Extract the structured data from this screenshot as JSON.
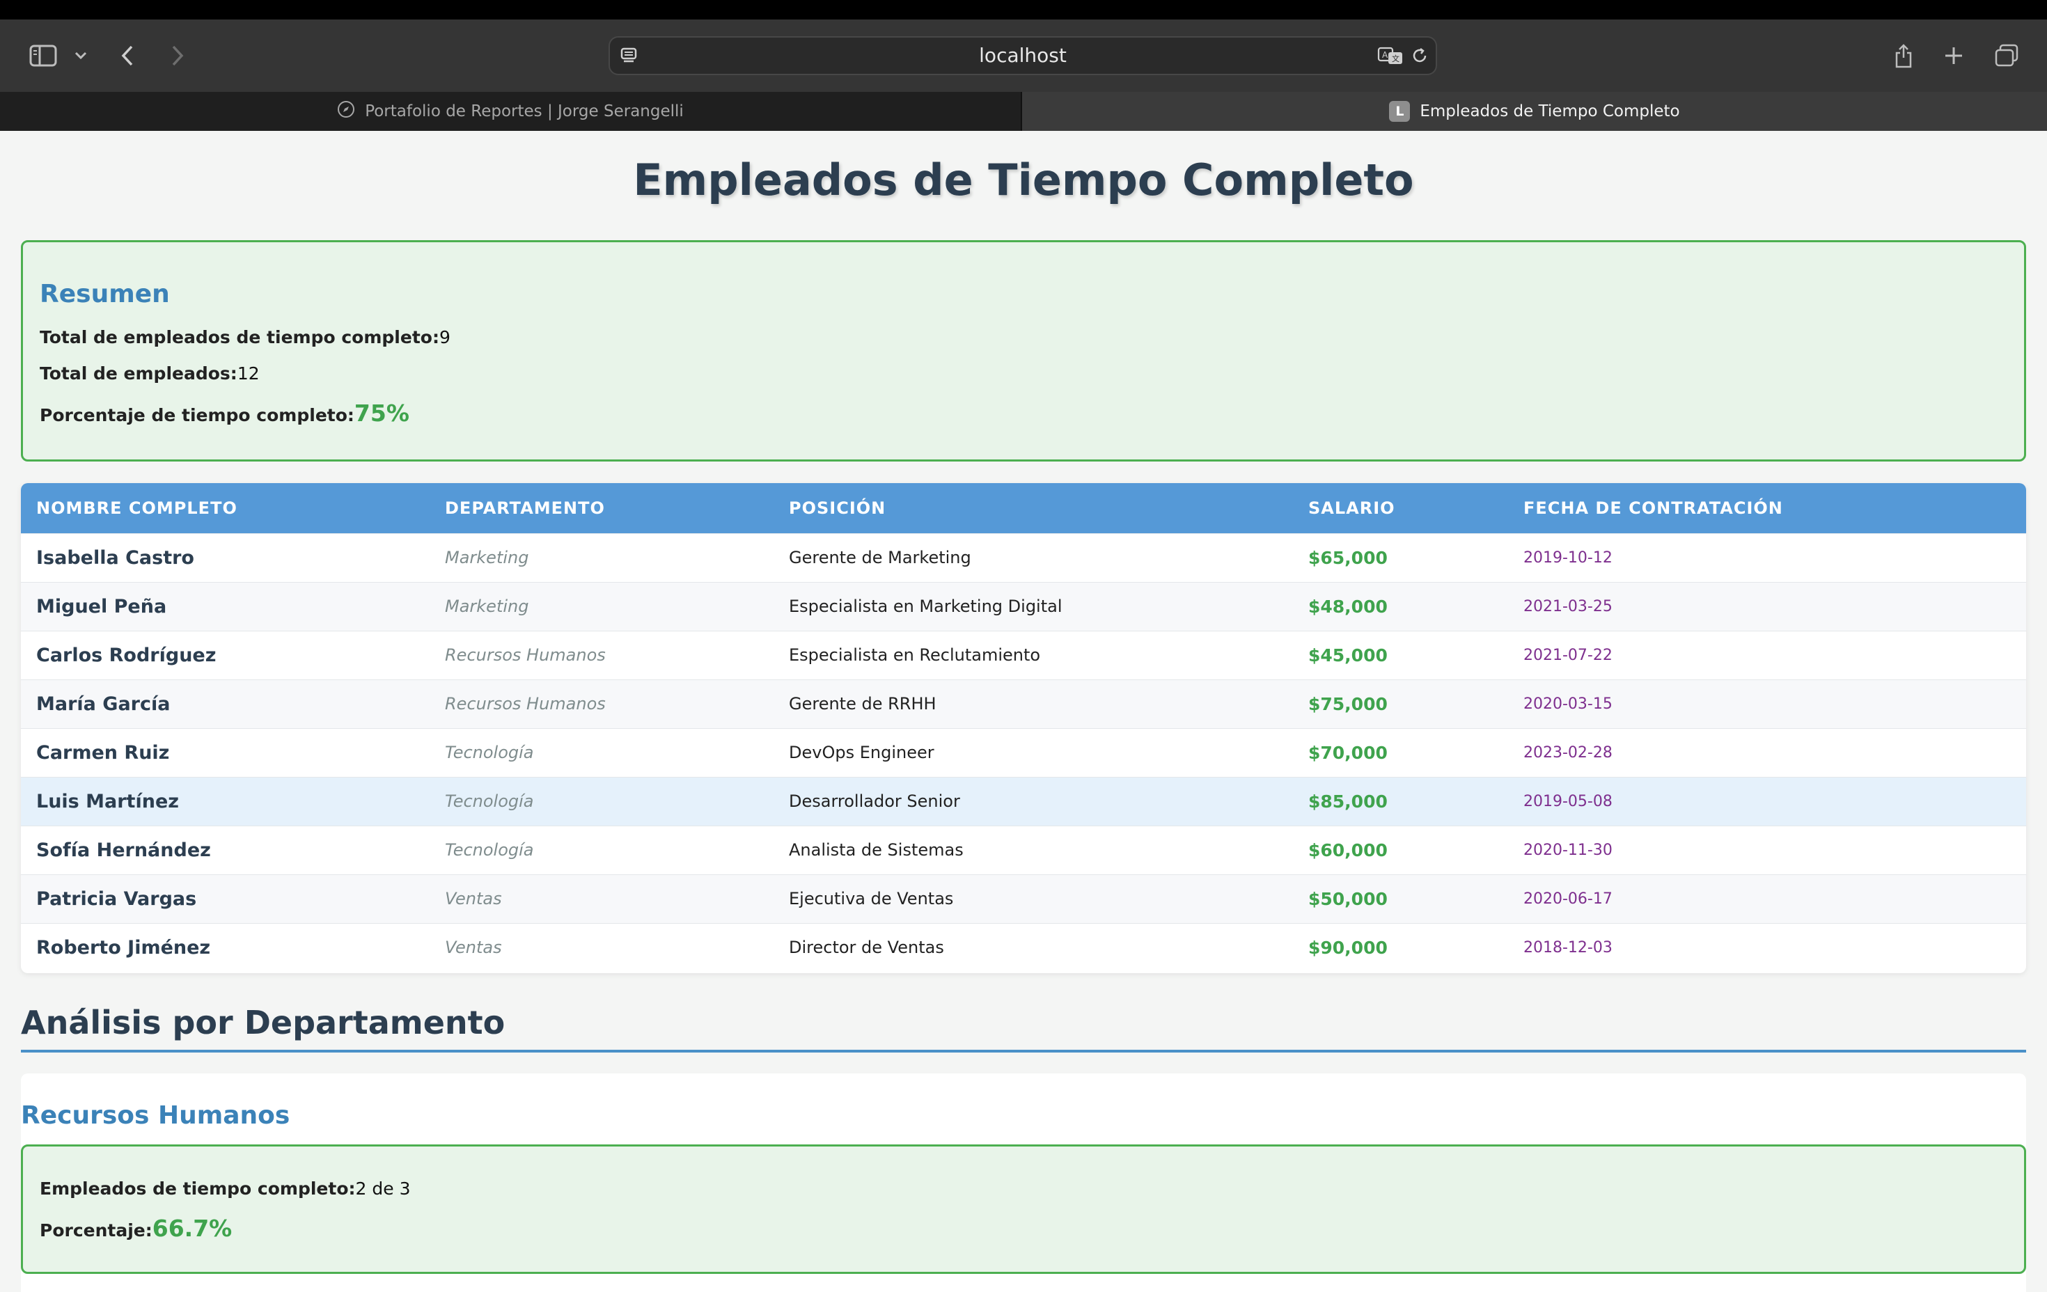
{
  "browser": {
    "url": "localhost",
    "tabs": [
      {
        "label": "Portafolio de Reportes | Jorge Serangelli",
        "active": false
      },
      {
        "label": "Empleados de Tiempo Completo",
        "active": true,
        "favicon_letter": "L"
      }
    ]
  },
  "page": {
    "title": "Empleados de Tiempo Completo",
    "summary": {
      "heading": "Resumen",
      "full_time_label": "Total de empleados de tiempo completo:",
      "full_time_value": "9",
      "total_label": "Total de empleados:",
      "total_value": "12",
      "percent_label": "Porcentaje de tiempo completo:",
      "percent_value": "75%"
    },
    "table": {
      "columns": [
        "NOMBRE COMPLETO",
        "DEPARTAMENTO",
        "POSICIÓN",
        "SALARIO",
        "FECHA DE CONTRATACIÓN"
      ],
      "rows": [
        [
          "Isabella Castro",
          "Marketing",
          "Gerente de Marketing",
          "$65,000",
          "2019-10-12"
        ],
        [
          "Miguel Peña",
          "Marketing",
          "Especialista en Marketing Digital",
          "$48,000",
          "2021-03-25"
        ],
        [
          "Carlos Rodríguez",
          "Recursos Humanos",
          "Especialista en Reclutamiento",
          "$45,000",
          "2021-07-22"
        ],
        [
          "María García",
          "Recursos Humanos",
          "Gerente de RRHH",
          "$75,000",
          "2020-03-15"
        ],
        [
          "Carmen Ruiz",
          "Tecnología",
          "DevOps Engineer",
          "$70,000",
          "2023-02-28"
        ],
        [
          "Luis Martínez",
          "Tecnología",
          "Desarrollador Senior",
          "$85,000",
          "2019-05-08"
        ],
        [
          "Sofía Hernández",
          "Tecnología",
          "Analista de Sistemas",
          "$60,000",
          "2020-11-30"
        ],
        [
          "Patricia Vargas",
          "Ventas",
          "Ejecutiva de Ventas",
          "$50,000",
          "2020-06-17"
        ],
        [
          "Roberto Jiménez",
          "Ventas",
          "Director de Ventas",
          "$90,000",
          "2018-12-03"
        ]
      ]
    },
    "department_analysis": {
      "heading": "Análisis por Departamento",
      "departments": [
        {
          "name": "Recursos Humanos",
          "full_time_label": "Empleados de tiempo completo:",
          "full_time_value": "2 de 3",
          "percent_label": "Porcentaje:",
          "percent_value": "66.7%"
        }
      ]
    }
  },
  "colors": {
    "accent_blue": "#5599d7",
    "heading_dark": "#2c3e50",
    "success_green": "#3fa34d",
    "date_purple": "#7e2f8e"
  }
}
